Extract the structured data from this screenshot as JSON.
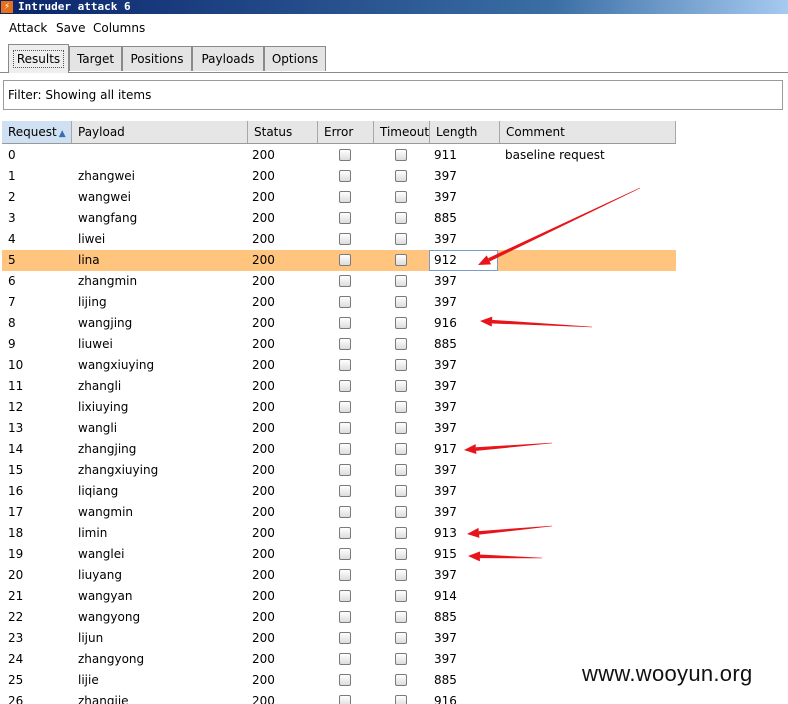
{
  "window": {
    "title": "Intruder attack 6",
    "icon": "burp-icon"
  },
  "menu": [
    "Attack",
    "Save",
    "Columns"
  ],
  "tabs": [
    {
      "label": "Results",
      "active": true
    },
    {
      "label": "Target",
      "active": false
    },
    {
      "label": "Positions",
      "active": false
    },
    {
      "label": "Payloads",
      "active": false
    },
    {
      "label": "Options",
      "active": false
    }
  ],
  "filter": {
    "text": "Filter: Showing all items"
  },
  "table": {
    "columns": [
      "Request",
      "Payload",
      "Status",
      "Error",
      "Timeout",
      "Length",
      "Comment"
    ],
    "sort_column": "Request",
    "sort_direction": "ascending",
    "selected_request": "5",
    "rows": [
      {
        "request": "0",
        "payload": "",
        "status": "200",
        "error": false,
        "timeout": false,
        "length": "911",
        "comment": "baseline request"
      },
      {
        "request": "1",
        "payload": "zhangwei",
        "status": "200",
        "error": false,
        "timeout": false,
        "length": "397",
        "comment": ""
      },
      {
        "request": "2",
        "payload": "wangwei",
        "status": "200",
        "error": false,
        "timeout": false,
        "length": "397",
        "comment": ""
      },
      {
        "request": "3",
        "payload": "wangfang",
        "status": "200",
        "error": false,
        "timeout": false,
        "length": "885",
        "comment": ""
      },
      {
        "request": "4",
        "payload": "liwei",
        "status": "200",
        "error": false,
        "timeout": false,
        "length": "397",
        "comment": ""
      },
      {
        "request": "5",
        "payload": "lina",
        "status": "200",
        "error": false,
        "timeout": false,
        "length": "912",
        "comment": ""
      },
      {
        "request": "6",
        "payload": "zhangmin",
        "status": "200",
        "error": false,
        "timeout": false,
        "length": "397",
        "comment": ""
      },
      {
        "request": "7",
        "payload": "lijing",
        "status": "200",
        "error": false,
        "timeout": false,
        "length": "397",
        "comment": ""
      },
      {
        "request": "8",
        "payload": "wangjing",
        "status": "200",
        "error": false,
        "timeout": false,
        "length": "916",
        "comment": ""
      },
      {
        "request": "9",
        "payload": "liuwei",
        "status": "200",
        "error": false,
        "timeout": false,
        "length": "885",
        "comment": ""
      },
      {
        "request": "10",
        "payload": "wangxiuying",
        "status": "200",
        "error": false,
        "timeout": false,
        "length": "397",
        "comment": ""
      },
      {
        "request": "11",
        "payload": "zhangli",
        "status": "200",
        "error": false,
        "timeout": false,
        "length": "397",
        "comment": ""
      },
      {
        "request": "12",
        "payload": "lixiuying",
        "status": "200",
        "error": false,
        "timeout": false,
        "length": "397",
        "comment": ""
      },
      {
        "request": "13",
        "payload": "wangli",
        "status": "200",
        "error": false,
        "timeout": false,
        "length": "397",
        "comment": ""
      },
      {
        "request": "14",
        "payload": "zhangjing",
        "status": "200",
        "error": false,
        "timeout": false,
        "length": "917",
        "comment": ""
      },
      {
        "request": "15",
        "payload": "zhangxiuying",
        "status": "200",
        "error": false,
        "timeout": false,
        "length": "397",
        "comment": ""
      },
      {
        "request": "16",
        "payload": "liqiang",
        "status": "200",
        "error": false,
        "timeout": false,
        "length": "397",
        "comment": ""
      },
      {
        "request": "17",
        "payload": "wangmin",
        "status": "200",
        "error": false,
        "timeout": false,
        "length": "397",
        "comment": ""
      },
      {
        "request": "18",
        "payload": "limin",
        "status": "200",
        "error": false,
        "timeout": false,
        "length": "913",
        "comment": ""
      },
      {
        "request": "19",
        "payload": "wanglei",
        "status": "200",
        "error": false,
        "timeout": false,
        "length": "915",
        "comment": ""
      },
      {
        "request": "20",
        "payload": "liuyang",
        "status": "200",
        "error": false,
        "timeout": false,
        "length": "397",
        "comment": ""
      },
      {
        "request": "21",
        "payload": "wangyan",
        "status": "200",
        "error": false,
        "timeout": false,
        "length": "914",
        "comment": ""
      },
      {
        "request": "22",
        "payload": "wangyong",
        "status": "200",
        "error": false,
        "timeout": false,
        "length": "885",
        "comment": ""
      },
      {
        "request": "23",
        "payload": "lijun",
        "status": "200",
        "error": false,
        "timeout": false,
        "length": "397",
        "comment": ""
      },
      {
        "request": "24",
        "payload": "zhangyong",
        "status": "200",
        "error": false,
        "timeout": false,
        "length": "397",
        "comment": ""
      },
      {
        "request": "25",
        "payload": "lijie",
        "status": "200",
        "error": false,
        "timeout": false,
        "length": "885",
        "comment": ""
      },
      {
        "request": "26",
        "payload": "zhangjie",
        "status": "200",
        "error": false,
        "timeout": false,
        "length": "916",
        "comment": ""
      }
    ]
  },
  "annotations": {
    "arrow_color": "#e8141b",
    "highlighted_requests": [
      "5",
      "8",
      "14",
      "18",
      "19"
    ]
  },
  "watermark": {
    "text": "www.wooyun.org"
  },
  "colors": {
    "selected_row": "#ffc57f",
    "titlebar": "#0a246a"
  }
}
